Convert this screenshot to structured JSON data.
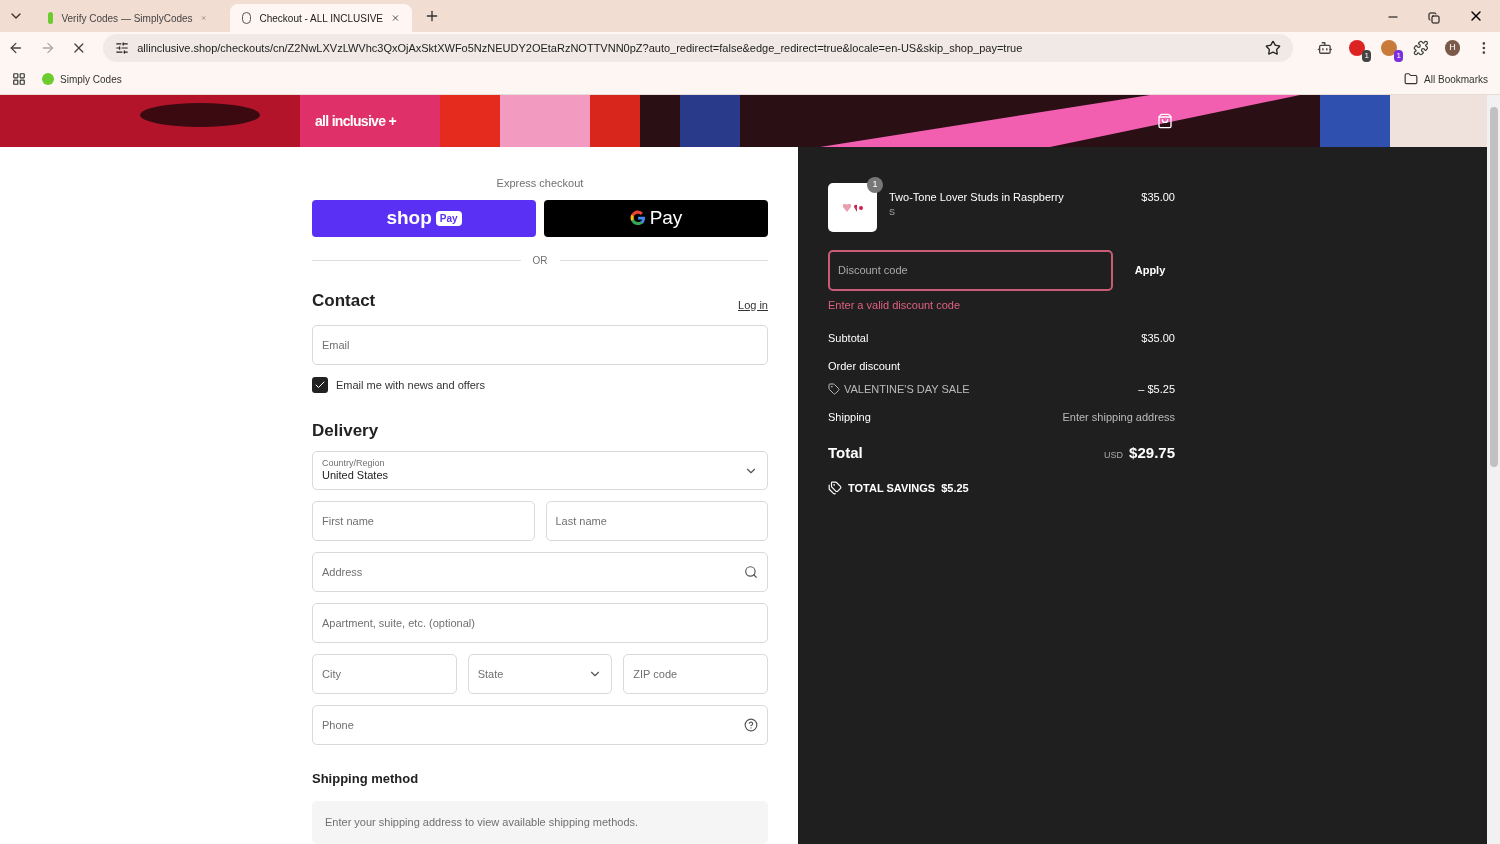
{
  "browser": {
    "tabs": [
      {
        "title": "Verify Codes — SimplyCodes",
        "selected": false
      },
      {
        "title": "Checkout - ALL INCLUSIVE",
        "selected": true
      }
    ],
    "url": "allinclusive.shop/checkouts/cn/Z2NwLXVzLWVhc3QxOjAxSktXWFo5NzNEUDY2OEtaRzNOTTVNN0pZ?auto_redirect=false&edge_redirect=true&locale=en-US&skip_shop_pay=true",
    "extension_badges": [
      "1",
      "1"
    ],
    "profile": "H",
    "bookmarks": [
      "Simply Codes"
    ],
    "all_bookmarks": "All Bookmarks"
  },
  "header": {
    "logo": "all inclusive +"
  },
  "express": {
    "title": "Express checkout",
    "shop_pay": {
      "word": "shop",
      "badge": "Pay"
    },
    "google_pay": {
      "word": "Pay"
    },
    "divider": "OR"
  },
  "contact": {
    "title": "Contact",
    "login": "Log in",
    "email": {
      "placeholder": "Email"
    },
    "newsletter": {
      "label": "Email me with news and offers",
      "checked": true
    }
  },
  "delivery": {
    "title": "Delivery",
    "country": {
      "label": "Country/Region",
      "value": "United States"
    },
    "fields": [
      {
        "placeholder": "First name",
        "kind": "text"
      },
      {
        "placeholder": "Last name",
        "kind": "text"
      }
    ],
    "address": {
      "placeholder": "Address"
    },
    "apartment": {
      "placeholder": "Apartment, suite, etc. (optional)"
    },
    "city": {
      "placeholder": "City"
    },
    "state": {
      "placeholder": "State"
    },
    "zip": {
      "placeholder": "ZIP code"
    },
    "phone": {
      "placeholder": "Phone"
    }
  },
  "shipping_method": {
    "title": "Shipping method",
    "note": "Enter your shipping address to view available shipping methods."
  },
  "summary": {
    "item": {
      "quantity": "1",
      "name": "Two-Tone Lover Studs in Raspberry",
      "variant": "S",
      "price": "$35.00"
    },
    "discount": {
      "placeholder": "Discount code",
      "button": "Apply",
      "error": "Enter a valid discount code"
    },
    "subtotal": {
      "label": "Subtotal",
      "value": "$35.00"
    },
    "order_discount": {
      "label": "Order discount",
      "code": "VALENTINE'S DAY SALE",
      "value": "– $5.25"
    },
    "shipping": {
      "label": "Shipping",
      "value": "Enter shipping address"
    },
    "total": {
      "label": "Total",
      "currency": "USD",
      "value": "$29.75"
    },
    "savings": {
      "label": "TOTAL SAVINGS",
      "value": "$5.25"
    }
  }
}
